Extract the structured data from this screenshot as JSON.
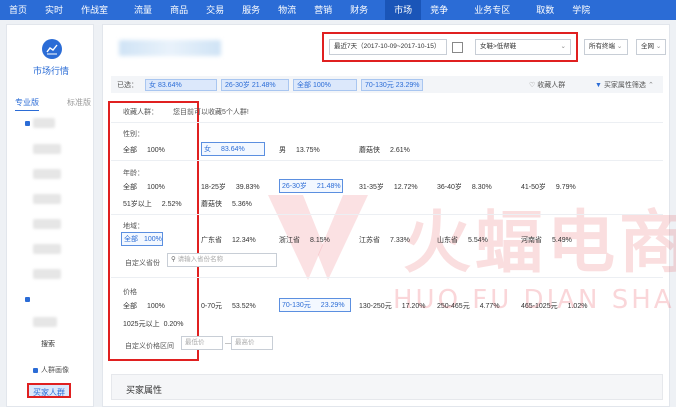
{
  "nav": {
    "items": [
      "首页",
      "实时",
      "作战室",
      "流量",
      "商品",
      "交易",
      "服务",
      "物流",
      "营销",
      "财务",
      "市场",
      "竞争",
      "业务专区",
      "取数",
      "学院"
    ],
    "active_index": 10
  },
  "sidebar": {
    "title": "市场行情",
    "tab_pro": "专业版",
    "tab_std": "标准版",
    "sub_label": "搜索",
    "persona_label": "人群画像",
    "active_item": "买家人群"
  },
  "toolbar": {
    "date_range": "最近7天（2017-10-09~2017-10-15）",
    "category": "女鞋>低帮鞋",
    "terminal": "所有终端",
    "scope": "全网"
  },
  "filter_bar": {
    "label": "已选：",
    "chips": [
      "女 83.64%",
      "26-30岁 21.48%",
      "全部 100%",
      "70-130元 23.29%"
    ],
    "favorite": "收藏人群",
    "attr_filter": "买家属性筛选"
  },
  "saved_crowd": {
    "label": "收藏人群：",
    "hint": "您目前可以收藏5个人群!"
  },
  "gender": {
    "label": "性别：",
    "options": [
      {
        "name": "全部",
        "value": "100%"
      },
      {
        "name": "女",
        "value": "83.64%"
      },
      {
        "name": "男",
        "value": "13.75%"
      },
      {
        "name": "蘑菇侠",
        "value": "2.61%"
      }
    ]
  },
  "age": {
    "label": "年龄：",
    "options": [
      {
        "name": "全部",
        "value": "100%"
      },
      {
        "name": "18-25岁",
        "value": "39.83%"
      },
      {
        "name": "26-30岁",
        "value": "21.48%"
      },
      {
        "name": "31-35岁",
        "value": "12.72%"
      },
      {
        "name": "36-40岁",
        "value": "8.30%"
      },
      {
        "name": "41-50岁",
        "value": "9.79%"
      },
      {
        "name": "51岁以上",
        "value": "2.52%"
      },
      {
        "name": "蘑菇侠",
        "value": "5.36%"
      }
    ]
  },
  "region": {
    "label": "地域：",
    "options": [
      {
        "name": "全部",
        "value": "100%"
      },
      {
        "name": "广东省",
        "value": "12.34%"
      },
      {
        "name": "浙江省",
        "value": "8.15%"
      },
      {
        "name": "江苏省",
        "value": "7.33%"
      },
      {
        "name": "山东省",
        "value": "5.54%"
      },
      {
        "name": "河南省",
        "value": "5.49%"
      }
    ],
    "custom_label": "自定义省份",
    "custom_placeholder": "请输入省份名称"
  },
  "price": {
    "label": "价格",
    "options": [
      {
        "name": "全部",
        "value": "100%"
      },
      {
        "name": "0-70元",
        "value": "53.52%"
      },
      {
        "name": "70-130元",
        "value": "23.29%"
      },
      {
        "name": "130-250元",
        "value": "17.20%"
      },
      {
        "name": "250-465元",
        "value": "4.77%"
      },
      {
        "name": "465-1025元",
        "value": "1.02%"
      },
      {
        "name": "1025元以上",
        "value": "0.20%"
      }
    ],
    "custom_label": "自定义价格区间",
    "min_placeholder": "最低价",
    "max_placeholder": "最高价",
    "dash": "—"
  },
  "footer": {
    "title": "买家属性"
  },
  "watermark": {
    "cn": "火蝠电商",
    "en": "HUO FU DIAN SHANG"
  }
}
